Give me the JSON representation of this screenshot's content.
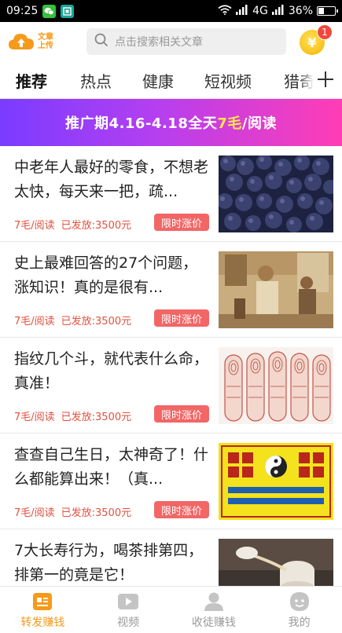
{
  "status_bar": {
    "time": "09:25",
    "network": "4G",
    "battery_text": "36%",
    "battery_level": 0.36,
    "icons": [
      "wechat-icon",
      "screen-app-icon",
      "wifi-icon",
      "signal-icon",
      "signal-icon",
      "battery-icon"
    ]
  },
  "header": {
    "logo_line1": "文章",
    "logo_line2": "上传",
    "search_placeholder": "点击搜索相关文章",
    "coin_symbol": "¥",
    "notification_count": "1"
  },
  "tabs": [
    {
      "label": "推荐",
      "active": true
    },
    {
      "label": "热点",
      "active": false
    },
    {
      "label": "健康",
      "active": false
    },
    {
      "label": "短视频",
      "active": false
    },
    {
      "label": "猎奇",
      "active": false
    }
  ],
  "tab_add_label": "+",
  "banner": {
    "prefix": "推广期4.16-4.18全天",
    "highlight": "7毛",
    "suffix": "/阅读"
  },
  "articles": [
    {
      "title": "中老年人最好的零食，不想老太快，每天来一把，疏...",
      "price": "7毛/阅读",
      "paid": "已发放:3500元",
      "tag": "限时涨价"
    },
    {
      "title": "史上最难回答的27个问题，涨知识！真的是很有...",
      "price": "7毛/阅读",
      "paid": "已发放:3500元",
      "tag": "限时涨价"
    },
    {
      "title": "指纹几个斗，就代表什么命，真准！",
      "price": "7毛/阅读",
      "paid": "已发放:3500元",
      "tag": "限时涨价"
    },
    {
      "title": "查查自己生日，太神奇了！什么都能算出来！（真...",
      "price": "7毛/阅读",
      "paid": "已发放:3500元",
      "tag": "限时涨价"
    },
    {
      "title": "7大长寿行为，喝茶排第四，排第一的竟是它！",
      "price": "",
      "paid": "",
      "tag": ""
    }
  ],
  "bottom_nav": [
    {
      "label": "转发赚钱",
      "active": true,
      "icon": "share-earn-icon"
    },
    {
      "label": "视频",
      "active": false,
      "icon": "video-icon"
    },
    {
      "label": "收徒赚钱",
      "active": false,
      "icon": "person-icon"
    },
    {
      "label": "我的",
      "active": false,
      "icon": "profile-face-icon"
    }
  ],
  "colors": {
    "accent": "#f59a1b",
    "tag_red": "#f26666",
    "banner_start": "#7a3cff",
    "banner_end": "#ff3db5",
    "highlight_yellow": "#ffe54a"
  }
}
